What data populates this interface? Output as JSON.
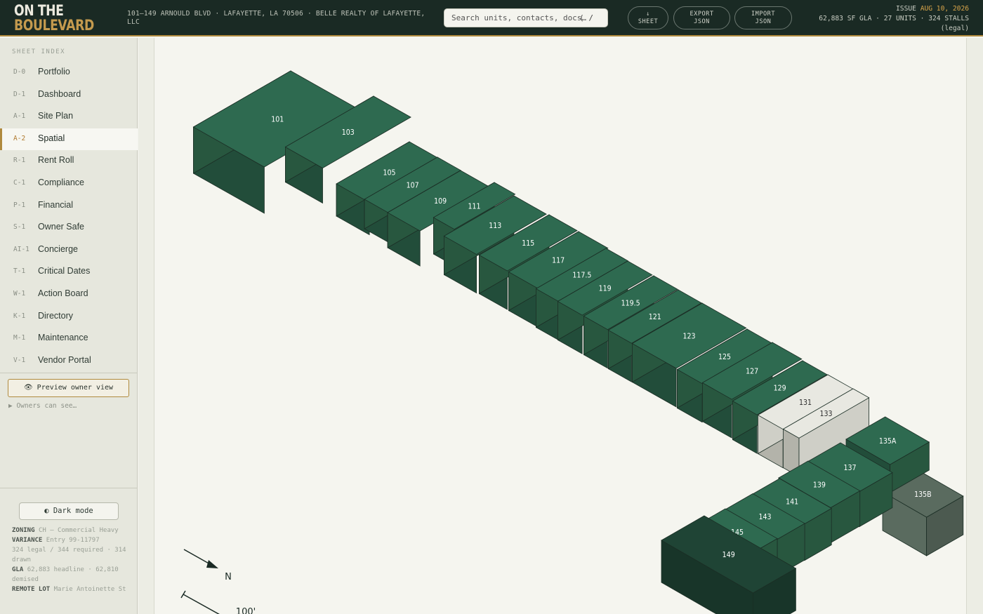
{
  "brand": {
    "line1": "ON THE",
    "line2": "BOULEVARD"
  },
  "header": {
    "address": "101–149 ARNOULD BLVD · LAFAYETTE, LA 70506 · BELLE REALTY OF LAFAYETTE, LLC",
    "search_placeholder": "Search units, contacts, docs…",
    "search_shortcut": "( /",
    "buttons": {
      "sheet_line1": "↓",
      "sheet_line2": "SHEET",
      "export_line1": "EXPORT",
      "export_line2": "JSON",
      "import_line1": "IMPORT",
      "import_line2": "JSON"
    },
    "issue_label": "ISSUE",
    "issue_date": "AUG 10, 2026",
    "stats": "62,883 SF GLA · 27 UNITS · 324 STALLS",
    "stats_note": "(legal)"
  },
  "sidebar": {
    "title": "SHEET INDEX",
    "items": [
      {
        "code": "D-0",
        "label": "Portfolio"
      },
      {
        "code": "D-1",
        "label": "Dashboard"
      },
      {
        "code": "A-1",
        "label": "Site Plan"
      },
      {
        "code": "A-2",
        "label": "Spatial"
      },
      {
        "code": "R-1",
        "label": "Rent Roll"
      },
      {
        "code": "C-1",
        "label": "Compliance"
      },
      {
        "code": "P-1",
        "label": "Financial"
      },
      {
        "code": "S-1",
        "label": "Owner Safe"
      },
      {
        "code": "AI-1",
        "label": "Concierge"
      },
      {
        "code": "T-1",
        "label": "Critical Dates"
      },
      {
        "code": "W-1",
        "label": "Action Board"
      },
      {
        "code": "K-1",
        "label": "Directory"
      },
      {
        "code": "M-1",
        "label": "Maintenance"
      },
      {
        "code": "V-1",
        "label": "Vendor Portal"
      }
    ],
    "active_code": "A-2",
    "preview_button": "👁 Preview owner view",
    "owners_toggle": "▶ Owners can see…",
    "dark_mode_button": "◐ Dark mode",
    "facts": {
      "zoning_label": "ZONING",
      "zoning_value": "CH — Commercial Heavy",
      "variance_label": "VARIANCE",
      "variance_value": "Entry 99-11797",
      "stalls_line": "324 legal / 344 required · 314 drawn",
      "gla_label": "GLA",
      "gla_value": "62,883 headline · 62,810 demised",
      "remote_label": "REMOTE LOT",
      "remote_value": "Marie Antoinette St"
    }
  },
  "spatial": {
    "north_label": "N",
    "scale_label": "100'",
    "colors": {
      "leased_top": "#2e6a50",
      "leased_left": "#224d3a",
      "leased_right": "#28573f",
      "vacant_top": "#e8e8e1",
      "vacant_left": "#b3b3aa",
      "vacant_right": "#cfcfc7",
      "other_top": "#5a6b5f",
      "other_right": "#4c5a50",
      "anchor_top": "#1f4435",
      "anchor_left": "#183529"
    },
    "units": [
      "101",
      "103",
      "105",
      "107",
      "109",
      "111",
      "113",
      "115",
      "117",
      "117.5",
      "119",
      "119.5",
      "121",
      "123",
      "125",
      "127",
      "129",
      "131",
      "133",
      "135A",
      "135B",
      "137",
      "139",
      "141",
      "143",
      "145",
      "149"
    ],
    "vacant_units": [
      "131",
      "133"
    ],
    "other_units": [
      "135B"
    ],
    "anchor_units": [
      "149"
    ]
  }
}
